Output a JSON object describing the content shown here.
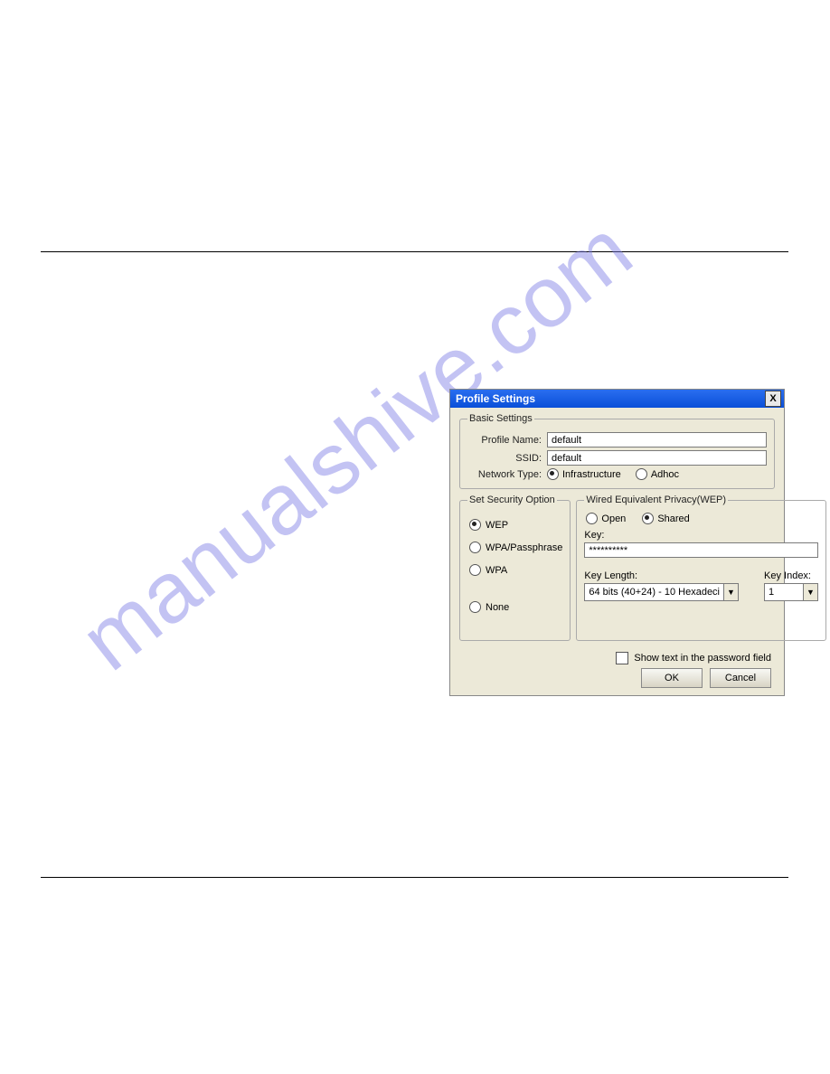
{
  "watermark": "manualshive.com",
  "dialog": {
    "title": "Profile Settings",
    "close_label": "X",
    "basic": {
      "legend": "Basic Settings",
      "profile_name_label": "Profile Name:",
      "profile_name_value": "default",
      "ssid_label": "SSID:",
      "ssid_value": "default",
      "network_type_label": "Network Type:",
      "infrastructure_label": "Infrastructure",
      "adhoc_label": "Adhoc"
    },
    "security": {
      "legend": "Set Security Option",
      "wep_label": "WEP",
      "wpa_pass_label": "WPA/Passphrase",
      "wpa_label": "WPA",
      "none_label": "None"
    },
    "wep": {
      "legend": "Wired Equivalent Privacy(WEP)",
      "open_label": "Open",
      "shared_label": "Shared",
      "key_label": "Key:",
      "key_value": "**********",
      "key_length_label": "Key Length:",
      "key_length_value": "64 bits (40+24) - 10 Hexadeci",
      "key_index_label": "Key Index:",
      "key_index_value": "1"
    },
    "show_text_label": "Show text in the password field",
    "ok_label": "OK",
    "cancel_label": "Cancel"
  }
}
